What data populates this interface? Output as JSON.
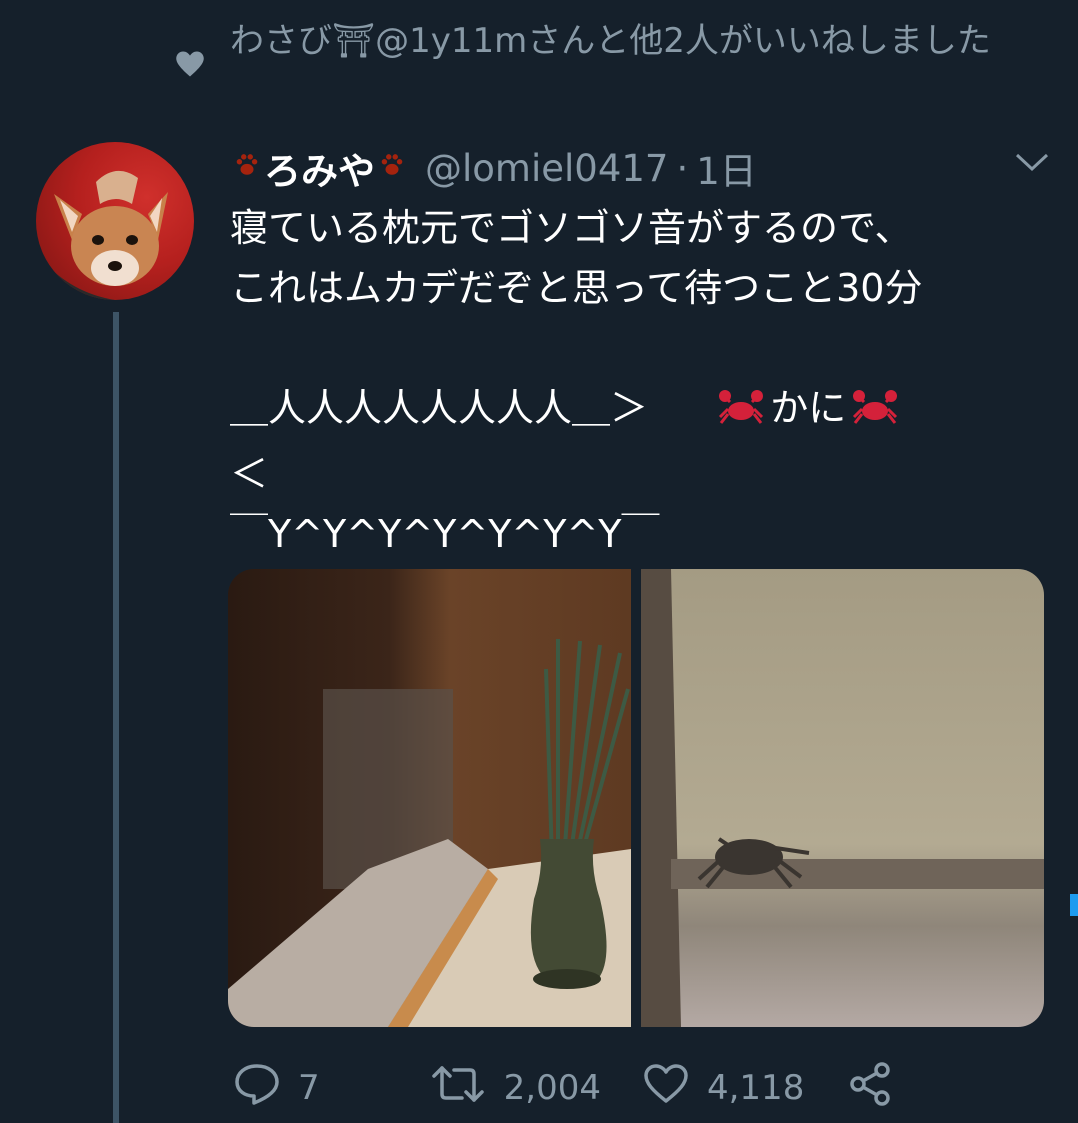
{
  "social_context": {
    "text": "わさび⛩@1y11mさんと他2人がいいねしました",
    "icon": "heart-icon"
  },
  "tweet": {
    "author": {
      "display_name": "ろみや",
      "handle": "@lomiel0417",
      "avatar": "fox-avatar"
    },
    "separator": "·",
    "time": "1日",
    "lines": [
      "寝ている枕元でゴソゴソ音がするので、",
      "これはムカデだぞと思って待つこと30分",
      "",
      "＿人人人人人人人人＿＞",
      "かに",
      "＜",
      "￣Y^Y^Y^Y^Y^Y^Y￣"
    ],
    "actions": {
      "reply": {
        "count": "7",
        "icon": "reply-icon"
      },
      "retweet": {
        "count": "2,004",
        "icon": "retweet-icon"
      },
      "like": {
        "count": "4,118",
        "icon": "heart-icon"
      },
      "share": {
        "icon": "share-icon"
      }
    }
  },
  "colors": {
    "background": "#15202b",
    "secondary_text": "#8899a6",
    "thread_line": "#3d5466",
    "crab": "#d4213a"
  }
}
